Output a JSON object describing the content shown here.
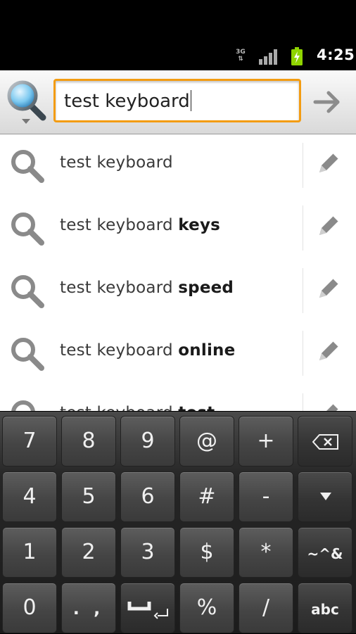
{
  "status_bar": {
    "network": "3G",
    "time": "4:25"
  },
  "search": {
    "query": "test keyboard",
    "go_icon": "arrow-right-icon",
    "engine_icon": "search-icon"
  },
  "suggestions": [
    {
      "base": "test keyboard",
      "suffix": ""
    },
    {
      "base": "test keyboard ",
      "suffix": "keys"
    },
    {
      "base": "test keyboard ",
      "suffix": "speed"
    },
    {
      "base": "test keyboard ",
      "suffix": "online"
    },
    {
      "base": "test keyboard ",
      "suffix": "test"
    }
  ],
  "keyboard": {
    "rows": [
      [
        "7",
        "8",
        "9",
        "@",
        "+",
        "⌫"
      ],
      [
        "4",
        "5",
        "6",
        "#",
        "-",
        "▼"
      ],
      [
        "1",
        "2",
        "3",
        "$",
        "*",
        "~^&"
      ],
      [
        "0",
        ". ,",
        "␣",
        "%",
        "/",
        "abc"
      ]
    ]
  },
  "colors": {
    "focus_border": "#f39c12",
    "keyboard_bg": "#1c1c1c",
    "key_bg": "#4f4f4f"
  }
}
